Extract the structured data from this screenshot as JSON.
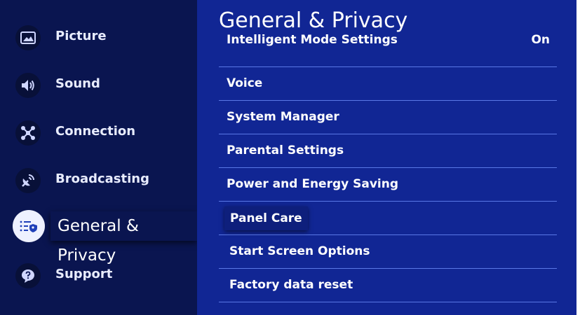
{
  "sidebar": {
    "items": [
      {
        "label": "Picture",
        "icon": "picture-icon"
      },
      {
        "label": "Sound",
        "icon": "speaker-icon"
      },
      {
        "label": "Connection",
        "icon": "network-icon"
      },
      {
        "label": "Broadcasting",
        "icon": "broadcast-icon"
      },
      {
        "label": "General & Privacy",
        "icon": "general-privacy-icon",
        "selected": true
      },
      {
        "label": "Support",
        "icon": "support-icon"
      }
    ]
  },
  "panel": {
    "title": "General & Privacy",
    "items": [
      {
        "label": "Intelligent Mode Settings",
        "value": "On"
      },
      {
        "label": "Voice"
      },
      {
        "label": "System Manager"
      },
      {
        "label": "Parental Settings"
      },
      {
        "label": "Power and Energy Saving"
      },
      {
        "label": "Panel Care",
        "focused": true
      },
      {
        "label": "Start Screen Options"
      },
      {
        "label": "Factory data reset"
      }
    ]
  },
  "colors": {
    "sidebar_bg": "#0a1550",
    "panel_bg": "#112694",
    "divider": "#5a78e6",
    "text": "#ffffff"
  }
}
